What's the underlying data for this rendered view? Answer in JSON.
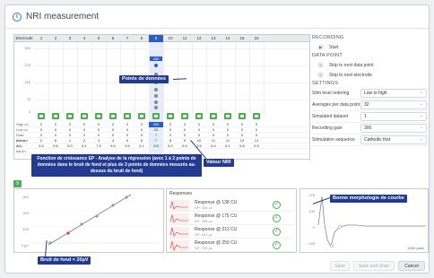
{
  "window": {
    "title": "NRI measurement"
  },
  "grid": {
    "electrode_label": "Electrode",
    "electrodes": [
      "1",
      "2",
      "3",
      "4",
      "5",
      "6",
      "7",
      "8",
      "9",
      "10",
      "11",
      "12",
      "13",
      "14",
      "15",
      "16"
    ],
    "selected_index": 8,
    "y_ticks": [
      "300",
      "225",
      "150",
      "75",
      "0"
    ],
    "row_labels": [
      "High cu",
      "Low cu",
      "Data points",
      "Record on",
      "Z(k)",
      "dat.lin"
    ],
    "rows": [
      [
        "0",
        "0",
        "0",
        "0",
        "0",
        "0",
        "0",
        "0",
        "250",
        "0",
        "0",
        "0",
        "0",
        "0",
        "0",
        "0"
      ],
      [
        "0",
        "0",
        "0",
        "0",
        "0",
        "0",
        "0",
        "0",
        "20",
        "0",
        "0",
        "0",
        "0",
        "0",
        "0",
        "0"
      ],
      [
        "0",
        "0",
        "0",
        "0",
        "0",
        "0",
        "0",
        "0",
        "7",
        "0",
        "0",
        "0",
        "0",
        "0",
        "0",
        "0"
      ],
      [
        "2",
        "8",
        "1",
        "2",
        "3",
        "4",
        "5",
        "6",
        "7",
        "8",
        "9",
        "10",
        "11",
        "12",
        "13",
        "14"
      ],
      [
        "5.5",
        "5.6",
        "6.0",
        "6.1",
        "7.5",
        "6.0",
        "9.6",
        "5.1",
        "3.6",
        "6.2",
        "6.9",
        "3.5",
        "6.4",
        "6.1",
        "5.8",
        "5.5"
      ],
      [
        "",
        "",
        "",
        "",
        "",
        "",
        "",
        "",
        "",
        "",
        "",
        "",
        "",
        "",
        "",
        ""
      ]
    ],
    "point_label": "250"
  },
  "settings": {
    "recording_heading": "RECORDING",
    "start_label": "Start",
    "data_point_heading": "DATA POINT",
    "skip_next_point": "Skip to next data point",
    "skip_next_electrode": "Skip to next electrode",
    "settings_heading": "SETTINGS",
    "fields": [
      {
        "label": "Stim level ordering",
        "value": "Low to high"
      },
      {
        "label": "Averages per data point",
        "value": "32"
      },
      {
        "label": "Simulated dataset",
        "value": "1"
      },
      {
        "label": "Recording gain",
        "value": "300"
      },
      {
        "label": "Stimulation sequence",
        "value": "Cathodic first"
      }
    ]
  },
  "lower": {
    "tab_label": "9",
    "growth_y_ticks": [
      "300",
      "200",
      "100",
      "0 µV"
    ],
    "responses_title": "Responses",
    "responses": [
      {
        "name": "Response @ 138 CU",
        "sub": "DP: 358 µv"
      },
      {
        "name": "Response @ 175 CU",
        "sub": "DP: 358 µv"
      },
      {
        "name": "Response @ 213 CU",
        "sub": "DP: 641 µv"
      },
      {
        "name": "Response @ 250 CU",
        "sub": "DP: 750 µv"
      }
    ],
    "wave_y_ticks": [
      "278",
      "139",
      "0",
      "-139"
    ],
    "wave_x_label": "1500 µsec"
  },
  "footer": {
    "save": "Save",
    "save_close": "Save and close",
    "cancel": "Cancel"
  },
  "callouts": {
    "points": "Points de données",
    "nri_value": "Valeur NRI",
    "growth": "Fonction de croissance EP - Analyse de la régression (avec 1 à 2 points de données dans le bruit de fond et plus de 3 points de données mesurés au-dessus du bruit de fond)",
    "morphology": "Bonne morphologie de courbe",
    "noise": "Bruit de fond < 20µV"
  },
  "colors": {
    "accent": "#2c5cc5",
    "callout": "#223a8f",
    "ok": "#4caf50"
  }
}
